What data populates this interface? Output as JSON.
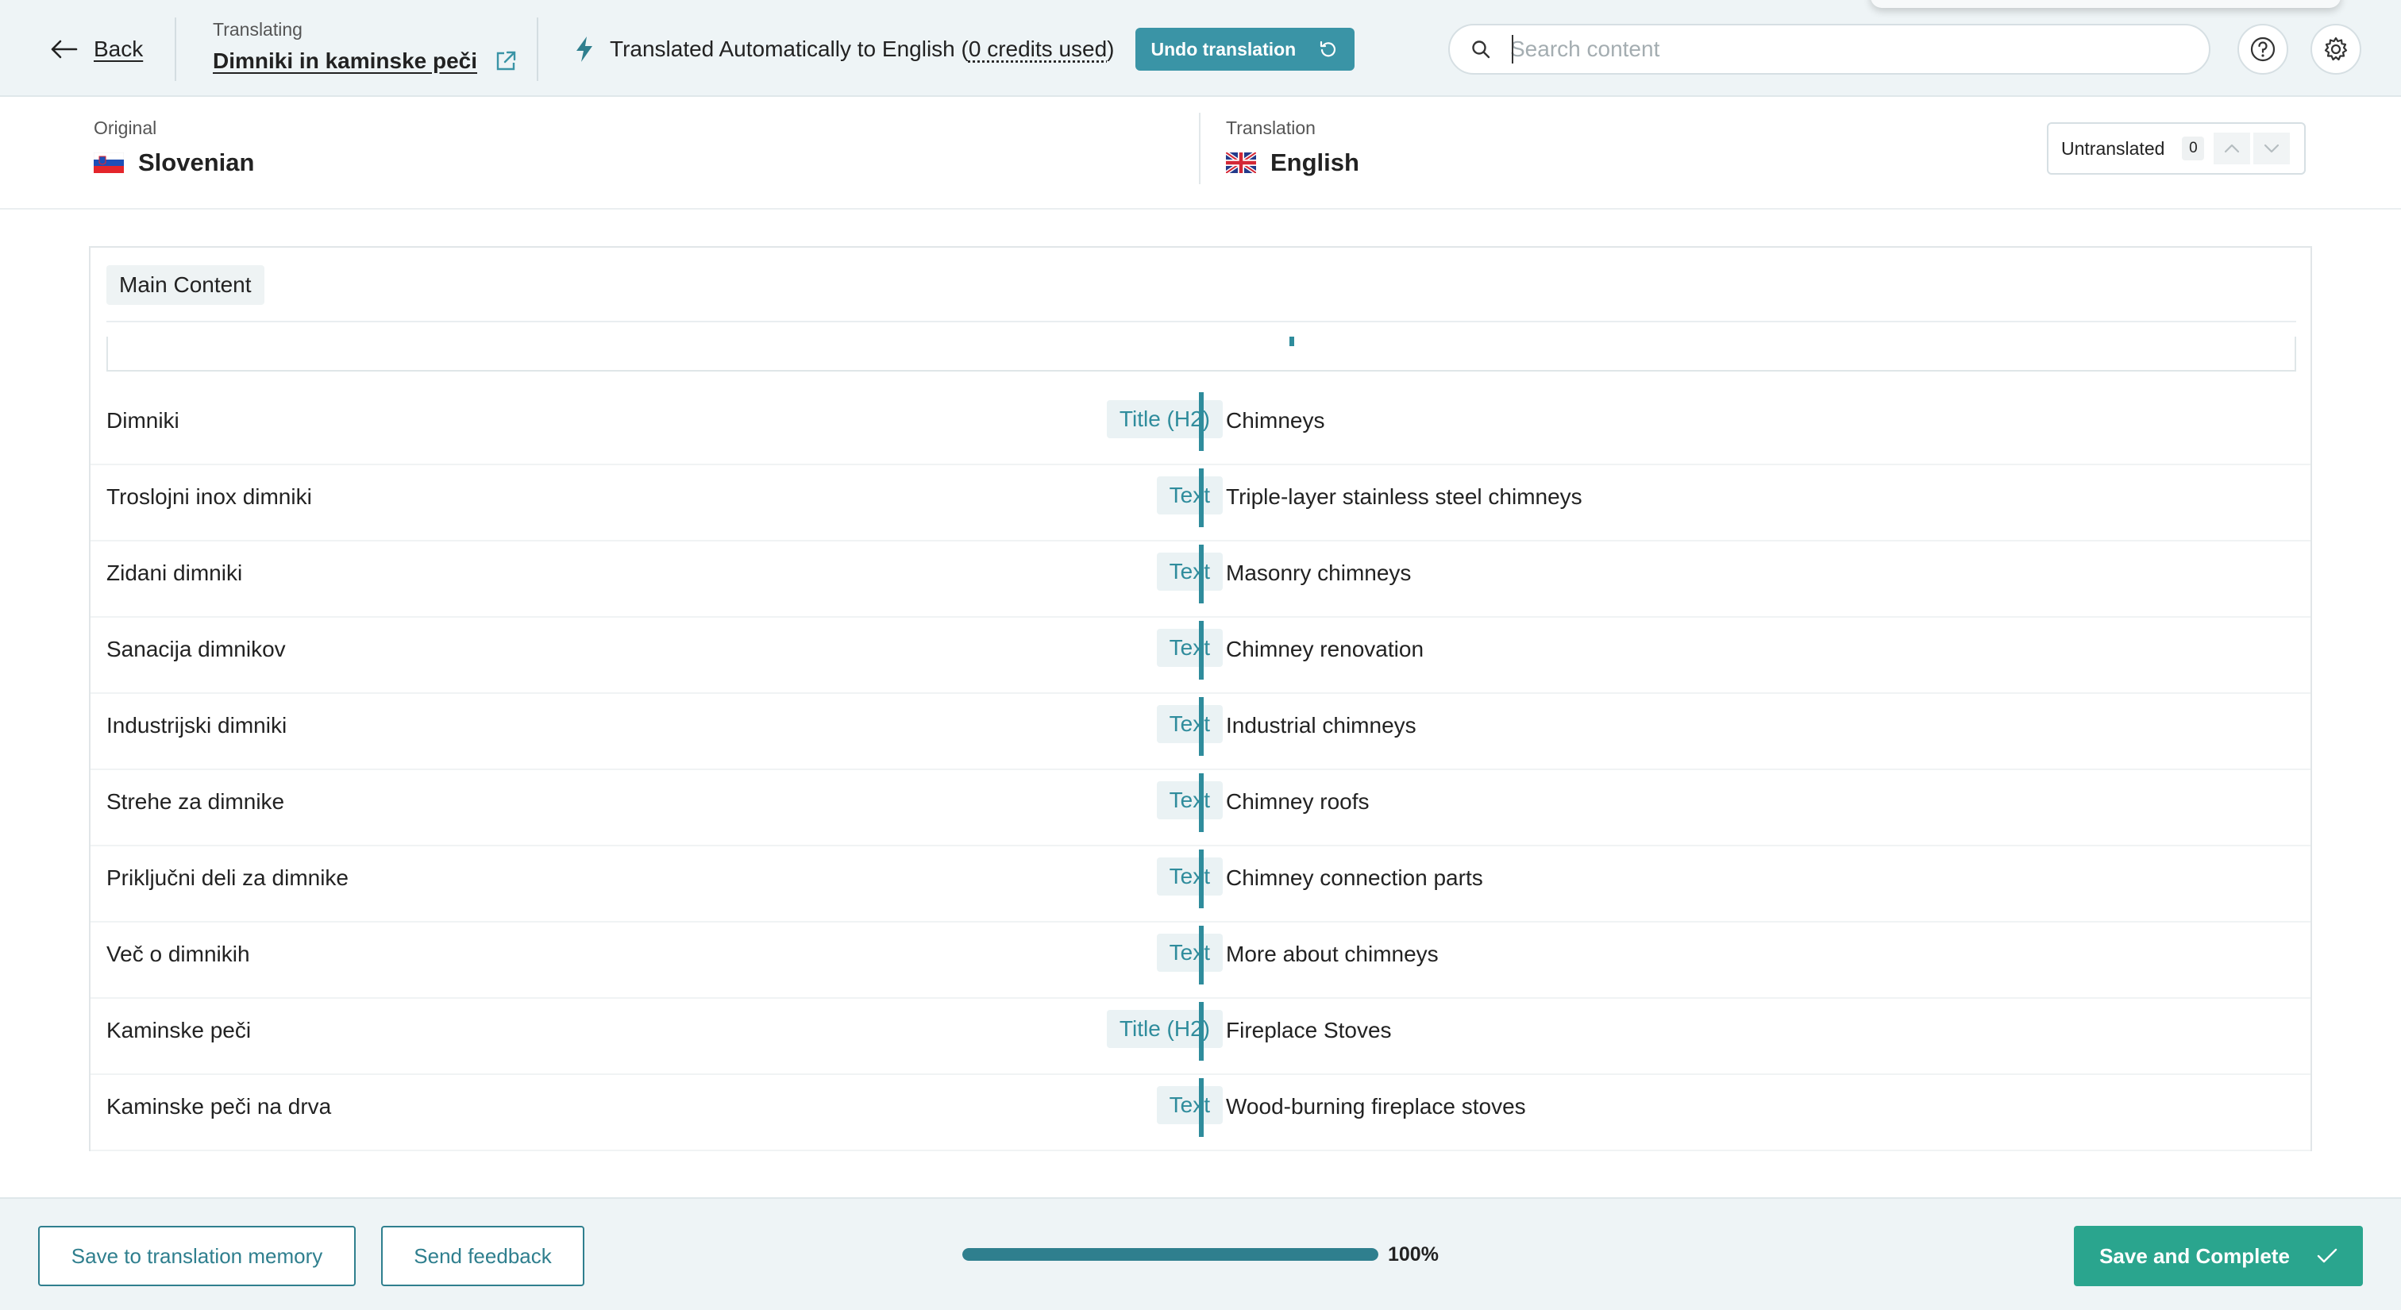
{
  "header": {
    "back_label": "Back",
    "translating_label": "Translating",
    "page_name": "Dimniki in kaminske peči",
    "auto_prefix": "Translated Automatically to English (",
    "credits_used": "0 credits used",
    "auto_suffix": ")",
    "undo_label": "Undo translation",
    "search_placeholder": "Search content",
    "search_value": ""
  },
  "languages": {
    "original_caption": "Original",
    "original_name": "Slovenian",
    "translation_caption": "Translation",
    "translation_name": "English",
    "untranslated_label": "Untranslated",
    "untranslated_count": "0"
  },
  "section": {
    "label": "Main Content"
  },
  "rows": [
    {
      "source": "Dimniki",
      "type": "Title (H2)",
      "target": "Chimneys"
    },
    {
      "source": "Troslojni inox dimniki",
      "type": "Text",
      "target": "Triple-layer stainless steel chimneys"
    },
    {
      "source": "Zidani dimniki",
      "type": "Text",
      "target": "Masonry chimneys"
    },
    {
      "source": "Sanacija dimnikov",
      "type": "Text",
      "target": "Chimney renovation"
    },
    {
      "source": "Industrijski dimniki",
      "type": "Text",
      "target": "Industrial chimneys"
    },
    {
      "source": "Strehe za dimnike",
      "type": "Text",
      "target": "Chimney roofs"
    },
    {
      "source": "Priključni deli za dimnike",
      "type": "Text",
      "target": "Chimney connection parts"
    },
    {
      "source": "Več o dimnikih",
      "type": "Text",
      "target": "More about chimneys"
    },
    {
      "source": "Kaminske peči",
      "type": "Title (H2)",
      "target": "Fireplace Stoves"
    },
    {
      "source": "Kaminske peči na drva",
      "type": "Text",
      "target": "Wood-burning fireplace stoves"
    }
  ],
  "footer": {
    "save_memory_label": "Save to translation memory",
    "feedback_label": "Send feedback",
    "progress_percent": 100,
    "progress_text": "100%",
    "complete_label": "Save and Complete"
  },
  "colors": {
    "accent": "#2f8c9c",
    "undo_button": "#3a94a6",
    "complete_button": "#2aa58e",
    "header_bg": "#eef4f6"
  }
}
